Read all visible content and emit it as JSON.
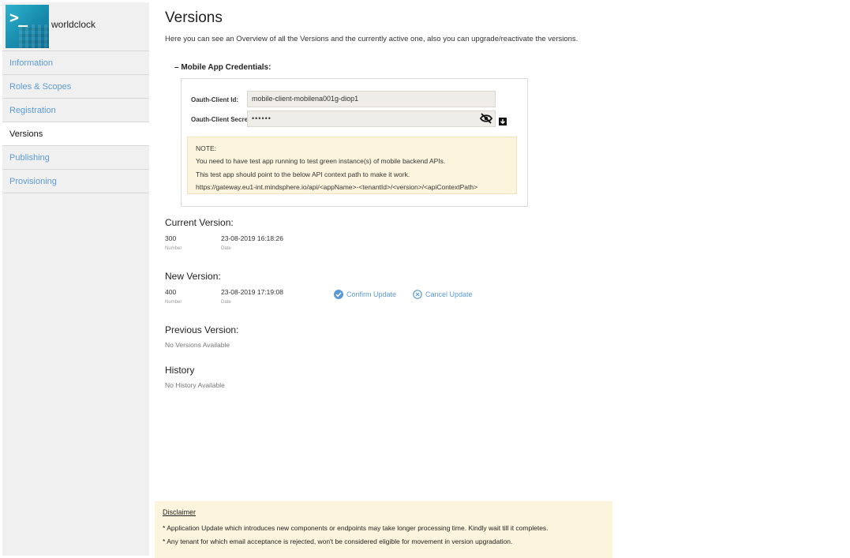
{
  "app": {
    "name": "worldclock",
    "logo_glyph": ">_",
    "accent": "#1a8fb0"
  },
  "sidebar": {
    "items": [
      {
        "label": "Information",
        "active": false
      },
      {
        "label": "Roles & Scopes",
        "active": false
      },
      {
        "label": "Registration",
        "active": false
      },
      {
        "label": "Versions",
        "active": true
      },
      {
        "label": "Publishing",
        "active": false
      },
      {
        "label": "Provisioning",
        "active": false
      }
    ]
  },
  "page": {
    "title": "Versions",
    "description": "Here you can see an Overview of all the Versions and the currently active one, also you can upgrade/reactivate the versions."
  },
  "credentials": {
    "toggle_symbol": "–",
    "section_title": "Mobile App Credentials:",
    "client_id_label": "Oauth-Client Id:",
    "client_id_value": "mobile-client-mobilena001g-diop1",
    "client_secret_label": "Oauth-Client Secret:",
    "client_secret_value": "••••••",
    "note": {
      "heading": "NOTE:",
      "line1": "You need to have test app running to test green instance(s) of mobile backend APIs.",
      "line2": "This test app should point to the below API context path to make it work.",
      "line3": "https://gateway.eu1-int.mindsphere.io/api/<appName>-<tenantId>/<version>/<apiContextPath>"
    }
  },
  "current_version": {
    "title": "Current Version:",
    "number": "300",
    "number_label": "Number",
    "date": "23-08-2019 16:18:26",
    "date_label": "Date"
  },
  "new_version": {
    "title": "New Version:",
    "number": "400",
    "number_label": "Number",
    "date": "23-08-2019 17:19:08",
    "date_label": "Date",
    "confirm_label": "Confirm Update",
    "cancel_label": "Cancel Update"
  },
  "previous_version": {
    "title": "Previous Version:",
    "empty": "No Versions Available"
  },
  "history": {
    "title": "History",
    "empty": "No History Available"
  },
  "disclaimer": {
    "title": "Disclaimer",
    "line1": "* Application Update which introduces new components or endpoints may take longer processing time. Kindly wait till it completes.",
    "line2": "* Any tenant for which email acceptance is rejected, won't be considered eligible for movement in version upgradation."
  },
  "colors": {
    "link": "#5b9bd5",
    "note_bg": "#fcf4dd",
    "sidebar_bg": "#f0f0f0"
  }
}
